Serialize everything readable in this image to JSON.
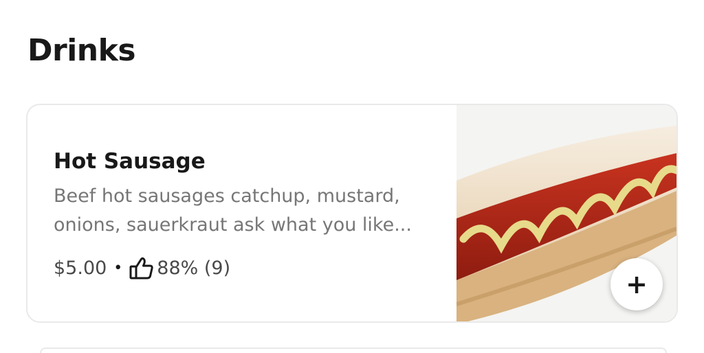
{
  "section": {
    "title": "Drinks"
  },
  "item": {
    "name": "Hot Sausage",
    "description": "Beef hot sausages catchup, mustard, onions, sauerkraut ask what you like...",
    "price": "$5.00",
    "separator": "•",
    "rating": "88% (9)",
    "rating_icon": "thumbs-up-icon",
    "add_icon": "plus-icon",
    "add_symbol": "+"
  }
}
